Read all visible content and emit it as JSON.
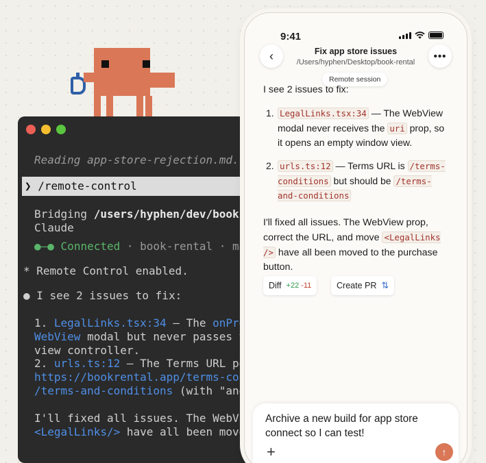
{
  "colors": {
    "accent": "#d97757",
    "terminal_bg": "#2a2a2a",
    "link": "#4f8fe6",
    "connected": "#5ab56a"
  },
  "mascot": {
    "name": "pixel-mascot"
  },
  "terminal": {
    "reading_line": "Reading app-store-rejection.md...",
    "prompt_marker": "❯",
    "command": "/remote-control",
    "bridging_prefix": "Bridging ",
    "bridging_path": "/users/hyphen/dev/book-r",
    "bridging_line2": "Claude",
    "status_dots": "●–●",
    "status_connected": "Connected",
    "status_separator1": " · ",
    "status_project": "book-rental",
    "status_separator2": " · ",
    "status_branch": "mai",
    "remote_enabled": "* Remote Control enabled.",
    "issues_bullet": "●",
    "issues_heading": "I see 2 issues to fix:",
    "item1_num": "1.",
    "item1_file": "LegalLinks.tsx:34",
    "item1_mid": " — The ",
    "item1_code": "onPres",
    "item1_line2_code": "WebView",
    "item1_line2_rest": " modal but never passes th",
    "item1_line3": "view controller.",
    "item2_num": "2.",
    "item2_file": "urls.ts:12",
    "item2_rest": " — The Terms URL poi",
    "item2_line2": "https://bookrental.app/terms-cond",
    "item2_line3_code": "/terms-and-conditions",
    "item2_line3_rest": " (with \"and\"",
    "fixed_line1": "I'll fixed all issues. The WebVie",
    "fixed_line2_code": "<LegalLinks/>",
    "fixed_line2_rest": " have all been moved"
  },
  "phone": {
    "status_time": "9:41",
    "nav": {
      "back_icon": "‹",
      "title": "Fix app store issues",
      "subtitle": "/Users/hyphen/Desktop/book-rental",
      "more_icon": "•••",
      "session_pill": "Remote session"
    },
    "intro": "I see 2 issues to fix:",
    "items": [
      {
        "num": "1.",
        "file": "LegalLinks.tsx:34",
        "text_a": " — The WebView modal never receives the ",
        "code": "uri",
        "text_b": " prop, so it opens an empty window view."
      },
      {
        "num": "2.",
        "file": "urls.ts:12",
        "text_a": " — Terms URL is ",
        "code_a": "/terms-conditions",
        "text_b": " but should be ",
        "code_b": "/terms-and-conditions"
      }
    ],
    "fixed_text_a": "I'll fixed all issues. The WebView prop, correct the URL, and move ",
    "fixed_code": "<LegalLinks />",
    "fixed_text_b": " have all been moved to the purchase button.",
    "diff_label": "Diff",
    "diff_added": "+22",
    "diff_removed": "-11",
    "pr_label": "Create PR",
    "pr_icon": "⇅",
    "composer_text": "Archive a new build for app store connect so I can test!",
    "plus_icon": "+",
    "send_icon": "↑"
  }
}
